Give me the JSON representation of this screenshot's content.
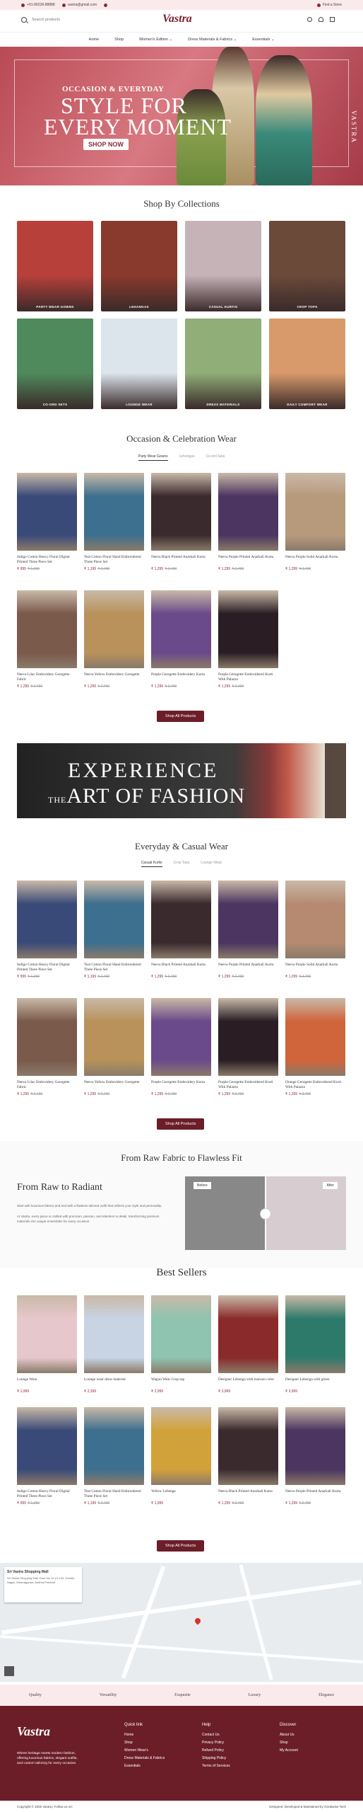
{
  "topbar": {
    "phone": "+91-89228-88888",
    "email": "vastra@gmail.com",
    "store": "Find a Store"
  },
  "header": {
    "search_placeholder": "Search products",
    "logo": "Vastra"
  },
  "nav": [
    "Home",
    "Shop",
    "Women's Edition ⌄",
    "Dress Materials & Fabrics ⌄",
    "Essentials ⌄"
  ],
  "hero": {
    "kicker": "OCCASION & EVERYDAY",
    "line1": "STYLE FOR",
    "line2": "EVERY MOMENT",
    "button": "SHOP NOW",
    "side": "VASTRA"
  },
  "collections": {
    "title": "Shop By Collections",
    "items": [
      "PARTY WEAR GOWNS",
      "LEHANGAS",
      "CASUAL KURTIS",
      "CROP TOPS",
      "CO-ORD SETS",
      "LOUNGE WEAR",
      "DRESS MATERIALS",
      "DAILY COMFORT WEAR"
    ],
    "colors": [
      "#b8403a",
      "#8a3a2c",
      "#c6b3b8",
      "#6b4a3a",
      "#4f8a5c",
      "#dce4ec",
      "#8fae78",
      "#d89a6b"
    ]
  },
  "occasion": {
    "title": "Occasion & Celebration Wear",
    "tabs": [
      "Party Wear Gowns",
      "Lehengas",
      "Co-ord Sets"
    ],
    "products": [
      {
        "name": "Indigo Cotton Heavy Floral Digital Printed Three Piece Set",
        "price": "₹ 999",
        "old": "₹ 1,999",
        "color": "#3a4a78"
      },
      {
        "name": "Teal Cotton Floral Hand Embroidered Three Piece Set",
        "price": "₹ 1,199",
        "old": "₹ 2,499",
        "color": "#3d6f8e"
      },
      {
        "name": "Neeva Black Printed Anarkali Kurta",
        "price": "₹ 1,299",
        "old": "₹ 2,499",
        "color": "#3a2a2e"
      },
      {
        "name": "Neeva Purple Printed Anarkali Kurta",
        "price": "₹ 1,299",
        "old": "₹ 2,499",
        "color": "#4c3560"
      },
      {
        "name": "Neeva Purple Solid Anarkali Kurta",
        "price": "₹ 1,299",
        "old": "₹ 2,499",
        "color": "#b79a7c"
      },
      {
        "name": "Neeva Lilac Embroidery Georgette Fabric",
        "price": "₹ 1,299",
        "old": "₹ 2,499",
        "color": "#7a5a4a"
      },
      {
        "name": "Neeva Yellow Embroidery Georgette",
        "price": "₹ 1,299",
        "old": "₹ 2,499",
        "color": "#b8925a"
      },
      {
        "name": "Purple Georgette Embroidery Kurta",
        "price": "₹ 1,299",
        "old": "₹ 2,499",
        "color": "#6a4a8a"
      },
      {
        "name": "Purple Georgette Embroidered Kurti With Palazzo",
        "price": "₹ 1,299",
        "old": "₹ 2,499",
        "color": "#2a1e24"
      }
    ],
    "button": "Shop All Products"
  },
  "banner": {
    "line1": "EXPERIENCE",
    "pre": "THE",
    "line2": "ART OF FASHION"
  },
  "everyday": {
    "title": "Everyday & Casual Wear",
    "tabs": [
      "Casual Kurtis",
      "Crop Tops",
      "Lounge Wear"
    ],
    "products": [
      {
        "name": "Indigo Cotton Heavy Floral Digital Printed Three Piece Set",
        "price": "₹ 999",
        "old": "₹ 1,999",
        "color": "#3a4a78"
      },
      {
        "name": "Teal Cotton Floral Hand Embroidered Three Piece Set",
        "price": "₹ 1,199",
        "old": "₹ 2,499",
        "color": "#3d6f8e"
      },
      {
        "name": "Neeva Black Printed Anarkali Kurta",
        "price": "₹ 1,299",
        "old": "₹ 2,499",
        "color": "#3a2a2e"
      },
      {
        "name": "Neeva Purple Printed Anarkali Kurta",
        "price": "₹ 1,299",
        "old": "₹ 2,499",
        "color": "#4c3560"
      },
      {
        "name": "Neeva Purple Solid Anarkali Kurta",
        "price": "₹ 1,299",
        "old": "₹ 2,499",
        "color": "#b58a70"
      },
      {
        "name": "Neeva Lilac Embroidery Georgette Fabric",
        "price": "₹ 1,299",
        "old": "₹ 2,499",
        "color": "#7a5a4a"
      },
      {
        "name": "Neeva Yellow Embroidery Georgette",
        "price": "₹ 1,299",
        "old": "₹ 2,499",
        "color": "#b8925a"
      },
      {
        "name": "Purple Georgette Embroidery Kurta",
        "price": "₹ 1,299",
        "old": "₹ 2,499",
        "color": "#6a4a8a"
      },
      {
        "name": "Purple Georgette Embroidered Kurti With Palazzo",
        "price": "₹ 1,299",
        "old": "₹ 2,499",
        "color": "#2a1e24"
      },
      {
        "name": "Orange Georgette Embroidered Kurti With Palazzo",
        "price": "₹ 1,299",
        "old": "₹ 2,499",
        "color": "#d0643a"
      }
    ],
    "button": "Shop All Products"
  },
  "raw": {
    "title": "From Raw Fabric to Flawless Fit",
    "heading": "From Raw to Radiant",
    "text1": "Start with luxurious fabrics and end with a flawless tailored outfit that reflects your style and personality.",
    "text2": "At Vastra, every piece is crafted with precision, passion, and attention to detail, transforming premium materials into unique ensembles for every occasion.",
    "before": "Before",
    "after": "After"
  },
  "bestsellers": {
    "title": "Best Sellers",
    "products": [
      {
        "name": "Lounge Wear",
        "price": "₹ 1,999",
        "color": "#e6c8cc"
      },
      {
        "name": "Lounge wear dress material",
        "price": "₹ 2,399",
        "color": "#c8d4e4"
      },
      {
        "name": "Wagon Wear Crop top",
        "price": "₹ 2,099",
        "color": "#8ec4b0"
      },
      {
        "name": "Designer Lehenga with maroon color",
        "price": "₹ 3,999",
        "color": "#8a2a2a"
      },
      {
        "name": "Designer Lehenga with green",
        "price": "₹ 3,999",
        "color": "#2e7a6a"
      },
      {
        "name": "Indigo Cotton Heavy Floral Digital Printed Three Piece Set",
        "price": "₹ 999",
        "old": "₹ 1,999",
        "color": "#3a4a78"
      },
      {
        "name": "Teal Cotton Floral Hand Embroidered Three Piece Set",
        "price": "₹ 1,199",
        "old": "₹ 2,499",
        "color": "#3d6f8e"
      },
      {
        "name": "Yellow Lehenga",
        "price": "₹ 1,999",
        "color": "#d2a23a"
      },
      {
        "name": "Neeva Black Printed Anarkali Kurta",
        "price": "₹ 1,299",
        "old": "₹ 2,499",
        "color": "#3a2a2e"
      },
      {
        "name": "Neeva Purple Printed Anarkali Kurta",
        "price": "₹ 1,299",
        "old": "₹ 2,499",
        "color": "#4c3560"
      }
    ],
    "button": "Shop All Products"
  },
  "map": {
    "place": "Sri Vastra Shopping Mall",
    "address": "Sri Vastra Shopping Mall, Door No 12-21-130, Gandhi Nagar, Vizianagaram, Andhra Pradesh"
  },
  "strip": [
    "Quality",
    "Versatility",
    "Exquisite",
    "Luxury",
    "Elegance"
  ],
  "footer": {
    "logo": "Vastra",
    "tagline": "Where heritage meets modern fashion, offering luxurious fabrics, elegant outfits, and custom tailoring for every occasion.",
    "quick": {
      "title": "Quick link",
      "items": [
        "Home",
        "Shop",
        "Women Wear's",
        "Dress Materials & Fabrics",
        "Essentials"
      ]
    },
    "help": {
      "title": "Help",
      "items": [
        "Contact Us",
        "Privacy Policy",
        "Refund Policy",
        "Shipping Policy",
        "Terms of Services"
      ]
    },
    "discover": {
      "title": "Discover",
      "items": [
        "About Us",
        "Shop",
        "My Account"
      ]
    },
    "copyright": "Copyright © 2025 Vastra  |  Follow us on:",
    "credit": "Designed, Developed & Maintained by Greatwise Tech"
  }
}
